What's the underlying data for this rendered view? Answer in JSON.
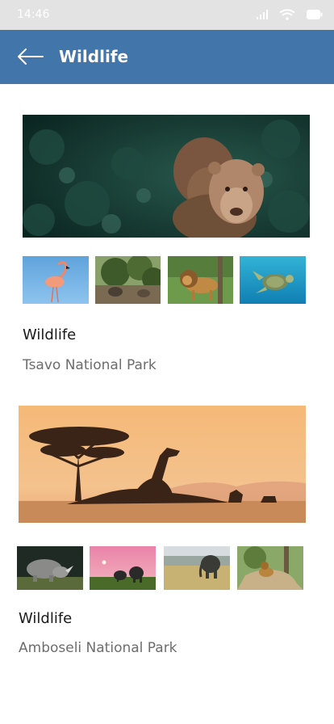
{
  "status_bar": {
    "time": "14:46",
    "icons": [
      "signal-icon",
      "wifi-icon",
      "battery-icon"
    ]
  },
  "app_bar": {
    "title": "Wildlife",
    "back_icon": "arrow-left-icon",
    "color": "#4275aa"
  },
  "cards": [
    {
      "title": "Wildlife",
      "subtitle": "Tsavo National Park",
      "hero": "lionesses-photo",
      "thumbnails": [
        "flamingo-photo",
        "hyenas-photo",
        "lion-photo",
        "sea-turtle-photo"
      ]
    },
    {
      "title": "Wildlife",
      "subtitle": "Amboseli National Park",
      "hero": "giraffe-sunset-photo",
      "thumbnails": [
        "rhino-photo",
        "elephants-dusk-photo",
        "elephant-photo",
        "lions-rock-photo"
      ]
    }
  ]
}
